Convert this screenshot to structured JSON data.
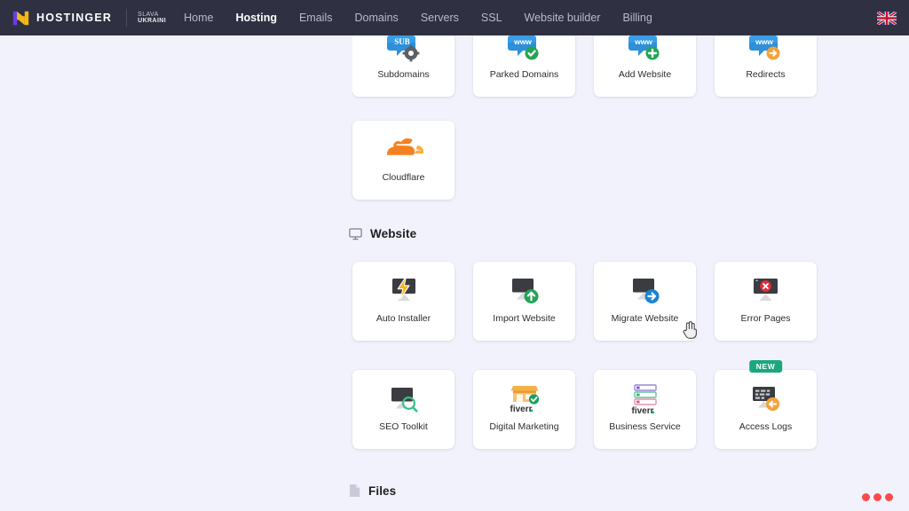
{
  "nav": {
    "brand": "HOSTINGER",
    "slogan_line1": "SLAVA",
    "slogan_line2": "UKRAINI",
    "links": [
      {
        "label": "Home",
        "active": false
      },
      {
        "label": "Hosting",
        "active": true
      },
      {
        "label": "Emails",
        "active": false
      },
      {
        "label": "Domains",
        "active": false
      },
      {
        "label": "Servers",
        "active": false
      },
      {
        "label": "SSL",
        "active": false
      },
      {
        "label": "Website builder",
        "active": false
      },
      {
        "label": "Billing",
        "active": false
      }
    ],
    "language_flag": "uk-flag-icon"
  },
  "domains_section": {
    "row_top": [
      {
        "label": "Subdomains",
        "icon": "subdomain-gear-icon"
      },
      {
        "label": "Parked Domains",
        "icon": "www-check-icon"
      },
      {
        "label": "Add Website",
        "icon": "www-plus-icon"
      },
      {
        "label": "Redirects",
        "icon": "www-arrow-icon"
      }
    ],
    "row_second": [
      {
        "label": "Cloudflare",
        "icon": "cloudflare-icon"
      }
    ]
  },
  "website_section": {
    "title": "Website",
    "icon": "monitor-icon",
    "row_one": [
      {
        "label": "Auto Installer",
        "icon": "monitor-bolt-icon",
        "badge": ""
      },
      {
        "label": "Import Website",
        "icon": "monitor-upload-icon",
        "badge": ""
      },
      {
        "label": "Migrate Website",
        "icon": "monitor-migrate-icon",
        "badge": ""
      },
      {
        "label": "Error Pages",
        "icon": "monitor-error-icon",
        "badge": ""
      }
    ],
    "row_two": [
      {
        "label": "SEO Toolkit",
        "icon": "monitor-search-icon",
        "badge": ""
      },
      {
        "label": "Digital Marketing",
        "icon": "fiverr-shop-icon",
        "badge": ""
      },
      {
        "label": "Business Service",
        "icon": "fiverr-list-icon",
        "badge": ""
      },
      {
        "label": "Access Logs",
        "icon": "access-logs-icon",
        "badge": "NEW"
      }
    ]
  },
  "files_section": {
    "title": "Files",
    "icon": "file-icon"
  },
  "colors": {
    "nav_background": "#2f3142",
    "page_background": "#f2f2fc",
    "card_background": "#ffffff",
    "brand_yellow": "#f5b819",
    "brand_blue": "#673de6",
    "badge_green": "#1aa87e",
    "record_red": "#fb4b4b",
    "cloudflare_orange": "#f48120"
  },
  "recording_indicator": {
    "name": "recording-dots",
    "dots": 3
  }
}
